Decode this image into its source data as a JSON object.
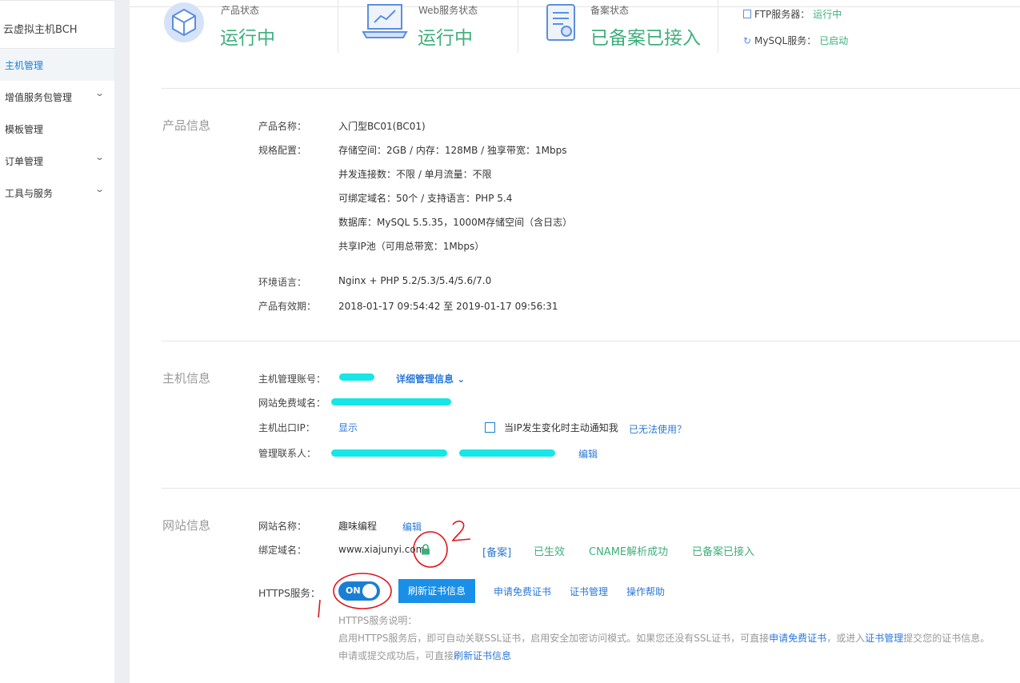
{
  "sidebar": {
    "title": "云虚拟主机BCH",
    "items": [
      {
        "label": "主机管理",
        "active": true
      },
      {
        "label": "增值服务包管理",
        "chevron": true
      },
      {
        "label": "模板管理"
      },
      {
        "label": "订单管理",
        "chevron": true
      },
      {
        "label": "工具与服务",
        "chevron": true
      }
    ]
  },
  "status": {
    "product": {
      "caption": "产品状态",
      "value": "运行中",
      "icon": "cube-icon"
    },
    "web": {
      "caption": "Web服务状态",
      "value": "运行中",
      "icon": "laptop-chart-icon"
    },
    "record": {
      "caption": "备案状态",
      "value": "已备案已接入",
      "icon": "document-icon"
    },
    "ftp": {
      "label": "FTP服务器：",
      "value": "运行中",
      "icon": "ftp-icon"
    },
    "mysql": {
      "label": "MySQL服务：",
      "value": "已启动",
      "icon": "mysql-icon"
    },
    "accent_color": "#3eaf7c"
  },
  "product_info": {
    "title": "产品信息",
    "name_label": "产品名称：",
    "name_value": "入门型BC01(BC01)",
    "spec_label": "规格配置：",
    "spec_lines": [
      "存储空间：2GB / 内存：128MB / 独享带宽：1Mbps",
      "并发连接数：不限 / 单月流量：不限",
      "可绑定域名：50个 / 支持语言：PHP 5.4",
      "数据库：MySQL 5.5.35，1000M存储空间（含日志）",
      "共享IP池（可用总带宽：1Mbps）"
    ],
    "env_label": "环境语言：",
    "env_value": "Nginx + PHP 5.2/5.3/5.4/5.6/7.0",
    "validity_label": "产品有效期：",
    "validity_value": "2018-01-17 09:54:42 至 2019-01-17 09:56:31"
  },
  "host_info": {
    "title": "主机信息",
    "account_label": "主机管理账号：",
    "detail_link": "详细管理信息",
    "domain_label": "网站免费域名：",
    "ip_label": "主机出口IP：",
    "ip_show": "显示",
    "notify_label": "当IP发生变化时主动通知我",
    "unavailable_link": "已无法使用？",
    "contact_label": "管理联系人：",
    "edit_link": "编辑"
  },
  "site_info": {
    "title": "网站信息",
    "name_label": "网站名称：",
    "name_value": "趣味编程",
    "name_edit": "编辑",
    "domain_label": "绑定域名：",
    "domain_value": "www.xiajunyi.com",
    "record_link": "[备案]",
    "effective": "已生效",
    "cname": "CNAME解析成功",
    "recorded": "已备案已接入",
    "https_label": "HTTPS服务：",
    "toggle_text": "ON",
    "toggle_on": true,
    "refresh_btn": "刷新证书信息",
    "apply_link": "申请免费证书",
    "cert_link": "证书管理",
    "help_link": "操作帮助",
    "note_title": "HTTPS服务说明：",
    "note_1a": "启用HTTPS服务后，即可自动关联SSL证书，启用安全加密访问模式。如果您还没有SSL证书，可直接",
    "note_1b": "申请免费证书",
    "note_1c": "，或进入",
    "note_1d": "证书管理",
    "note_1e": "提交您的证书信息。",
    "note_2a": "申请或提交成功后，可直接",
    "note_2b": "刷新证书信息"
  },
  "annotations": {
    "mark_1": "1",
    "mark_2": "2",
    "color": "#e0141e"
  }
}
